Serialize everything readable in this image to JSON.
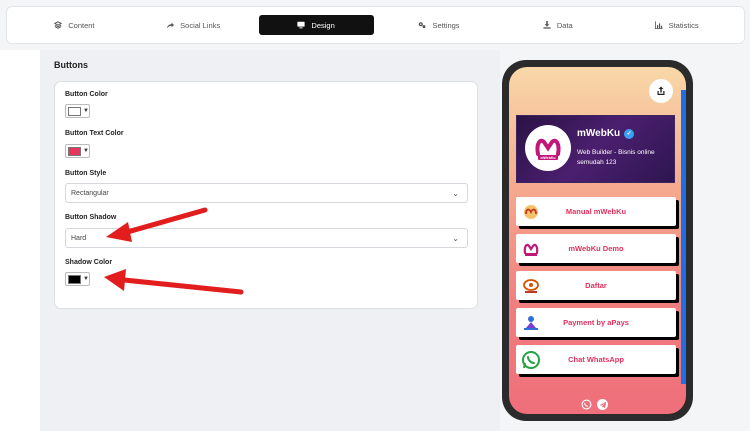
{
  "tabs": [
    {
      "label": "Content",
      "icon": "layers-icon"
    },
    {
      "label": "Social Links",
      "icon": "share-arrow-icon"
    },
    {
      "label": "Design",
      "icon": "monitor-icon",
      "active": true
    },
    {
      "label": "Settings",
      "icon": "gears-icon"
    },
    {
      "label": "Data",
      "icon": "download-icon"
    },
    {
      "label": "Statistics",
      "icon": "bar-chart-icon"
    }
  ],
  "section_title": "Buttons",
  "fields": {
    "button_color": {
      "label": "Button Color",
      "value": "#ffffff"
    },
    "button_text_color": {
      "label": "Button Text Color",
      "value": "#e8365f"
    },
    "button_style": {
      "label": "Button Style",
      "value": "Rectangular"
    },
    "button_shadow": {
      "label": "Button Shadow",
      "value": "Hard"
    },
    "shadow_color": {
      "label": "Shadow Color",
      "value": "#000000"
    }
  },
  "preview": {
    "profile_name": "mWebKu",
    "profile_desc": "Web Builder - Bisnis online semudah 123",
    "logo_text": "mWebKu",
    "links": [
      {
        "label": "Manual mWebKu",
        "icon": "mwebku-logo-icon"
      },
      {
        "label": "mWebKu Demo",
        "icon": "mwebku-logo-icon"
      },
      {
        "label": "Daftar",
        "icon": "daftar-logo-icon"
      },
      {
        "label": "Payment by aPays",
        "icon": "apays-logo-icon"
      },
      {
        "label": "Chat WhatsApp",
        "icon": "whatsapp-icon"
      }
    ],
    "footer_icons": [
      "whatsapp-icon",
      "telegram-icon"
    ]
  },
  "colors": {
    "accent": "#e0315e",
    "annotation_arrow": "#e11d1d",
    "active_tab": "#111111"
  }
}
